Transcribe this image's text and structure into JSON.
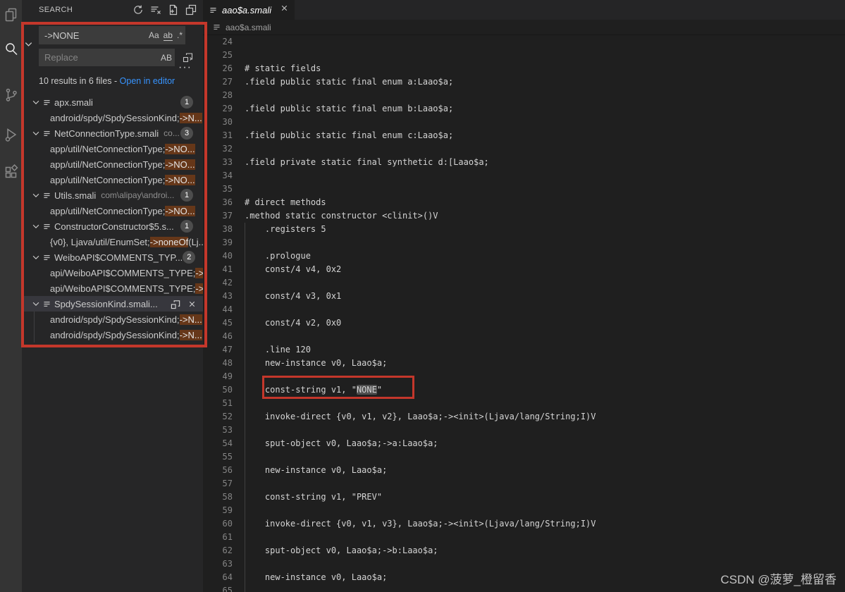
{
  "colors": {
    "annotation_red": "#c4372b",
    "result_match_highlight": "#663719",
    "editor_match_highlight": "#4f4f4f",
    "link_blue": "#3794ff",
    "badge_bg": "#4d4d4d"
  },
  "activity_bar": {
    "items": [
      {
        "icon": "explorer-icon",
        "active": false
      },
      {
        "icon": "search-icon",
        "active": true
      },
      {
        "icon": "source-control-icon",
        "active": false
      },
      {
        "icon": "run-debug-icon",
        "active": false
      },
      {
        "icon": "extensions-icon",
        "active": false
      }
    ]
  },
  "sidebar": {
    "title": "SEARCH",
    "header_icons": [
      "refresh-icon",
      "clear-results-icon",
      "new-search-editor-icon",
      "open-in-editor-icon"
    ],
    "search": {
      "value": "->NONE",
      "match_case_label": "Aa",
      "whole_word_label": "ab",
      "regex_label": ".*"
    },
    "replace": {
      "placeholder": "Replace",
      "preserve_case_label": "AB",
      "replace_all_icon": "replace-all-icon"
    },
    "more_actions_icon": "more-actions-icon",
    "summary": {
      "text": "10 results in 6 files -",
      "link": "Open in editor"
    },
    "results": [
      {
        "type": "file",
        "name": "apx.smali",
        "badge": "1"
      },
      {
        "type": "match",
        "pre": "android/spdy/SpdySessionKind;",
        "match": "->N...",
        "post": ""
      },
      {
        "type": "file",
        "name": "NetConnectionType.smali",
        "dir": "co...",
        "badge": "3"
      },
      {
        "type": "match",
        "pre": "app/util/NetConnectionType;",
        "match": "->NO...",
        "post": ""
      },
      {
        "type": "match",
        "pre": "app/util/NetConnectionType;",
        "match": "->NO...",
        "post": ""
      },
      {
        "type": "match",
        "pre": "app/util/NetConnectionType;",
        "match": "->NO...",
        "post": ""
      },
      {
        "type": "file",
        "name": "Utils.smali",
        "dir": "com\\alipay\\androi...",
        "badge": "1"
      },
      {
        "type": "match",
        "pre": "app/util/NetConnectionType;",
        "match": "->NO...",
        "post": ""
      },
      {
        "type": "file",
        "name": "ConstructorConstructor$5.s...",
        "badge": "1"
      },
      {
        "type": "match",
        "pre": "{v0}, Ljava/util/EnumSet;",
        "match": "->noneOf",
        "post": "(Lj..."
      },
      {
        "type": "file",
        "name": "WeiboAPI$COMMENTS_TYP...",
        "badge": "2"
      },
      {
        "type": "match",
        "pre": "api/WeiboAPI$COMMENTS_TYPE;",
        "match": "->...",
        "post": ""
      },
      {
        "type": "match",
        "pre": "api/WeiboAPI$COMMENTS_TYPE;",
        "match": "->...",
        "post": ""
      },
      {
        "type": "file",
        "name": "SpdySessionKind.smali...",
        "selected": true,
        "actions": [
          "replace-all-icon",
          "dismiss-icon"
        ]
      },
      {
        "type": "match",
        "pre": "android/spdy/SpdySessionKind;",
        "match": "->N...",
        "post": "",
        "guide": true
      },
      {
        "type": "match",
        "pre": "android/spdy/SpdySessionKind;",
        "match": "->N...",
        "post": "",
        "guide": true
      }
    ]
  },
  "editor": {
    "tab": {
      "label": "aao$a.smali",
      "close_icon": "close-icon"
    },
    "breadcrumb": {
      "file": "aao$a.smali"
    },
    "lines": [
      {
        "n": 24,
        "t": ""
      },
      {
        "n": 25,
        "t": ""
      },
      {
        "n": 26,
        "t": "# static fields"
      },
      {
        "n": 27,
        "t": ".field public static final enum a:Laao$a;"
      },
      {
        "n": 28,
        "t": ""
      },
      {
        "n": 29,
        "t": ".field public static final enum b:Laao$a;"
      },
      {
        "n": 30,
        "t": ""
      },
      {
        "n": 31,
        "t": ".field public static final enum c:Laao$a;"
      },
      {
        "n": 32,
        "t": ""
      },
      {
        "n": 33,
        "t": ".field private static final synthetic d:[Laao$a;"
      },
      {
        "n": 34,
        "t": ""
      },
      {
        "n": 35,
        "t": ""
      },
      {
        "n": 36,
        "t": "# direct methods"
      },
      {
        "n": 37,
        "t": ".method static constructor <clinit>()V"
      },
      {
        "n": 38,
        "t": "    .registers 5"
      },
      {
        "n": 39,
        "t": ""
      },
      {
        "n": 40,
        "t": "    .prologue"
      },
      {
        "n": 41,
        "t": "    const/4 v4, 0x2"
      },
      {
        "n": 42,
        "t": ""
      },
      {
        "n": 43,
        "t": "    const/4 v3, 0x1"
      },
      {
        "n": 44,
        "t": ""
      },
      {
        "n": 45,
        "t": "    const/4 v2, 0x0"
      },
      {
        "n": 46,
        "t": ""
      },
      {
        "n": 47,
        "t": "    .line 120"
      },
      {
        "n": 48,
        "t": "    new-instance v0, Laao$a;"
      },
      {
        "n": 49,
        "t": ""
      },
      {
        "n": 50,
        "pre": "    const-string v1, \"",
        "match": "NONE",
        "post": "\""
      },
      {
        "n": 51,
        "t": ""
      },
      {
        "n": 52,
        "t": "    invoke-direct {v0, v1, v2}, Laao$a;-><init>(Ljava/lang/String;I)V"
      },
      {
        "n": 53,
        "t": ""
      },
      {
        "n": 54,
        "t": "    sput-object v0, Laao$a;->a:Laao$a;"
      },
      {
        "n": 55,
        "t": ""
      },
      {
        "n": 56,
        "t": "    new-instance v0, Laao$a;"
      },
      {
        "n": 57,
        "t": ""
      },
      {
        "n": 58,
        "t": "    const-string v1, \"PREV\""
      },
      {
        "n": 59,
        "t": ""
      },
      {
        "n": 60,
        "t": "    invoke-direct {v0, v1, v3}, Laao$a;-><init>(Ljava/lang/String;I)V"
      },
      {
        "n": 61,
        "t": ""
      },
      {
        "n": 62,
        "t": "    sput-object v0, Laao$a;->b:Laao$a;"
      },
      {
        "n": 63,
        "t": ""
      },
      {
        "n": 64,
        "t": "    new-instance v0, Laao$a;"
      },
      {
        "n": 65,
        "t": ""
      }
    ]
  },
  "watermark": "CSDN @菠萝_橙留香"
}
